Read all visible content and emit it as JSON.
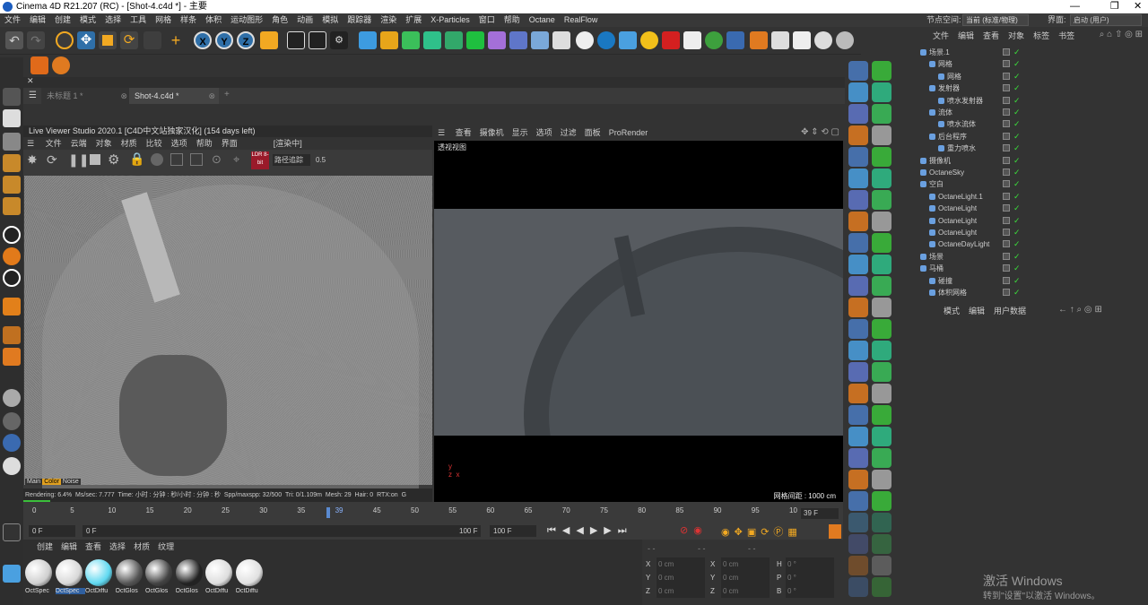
{
  "app": {
    "title": "Cinema 4D R21.207 (RC) - [Shot-4.c4d *] - 主要",
    "node_space_label": "节点空间:",
    "node_space_value": "当前 (标准/物理)",
    "layout_label": "界面:",
    "layout_value": "启动 (用户)"
  },
  "menu": [
    "文件",
    "编辑",
    "创建",
    "模式",
    "选择",
    "工具",
    "网格",
    "样条",
    "体积",
    "运动图形",
    "角色",
    "动画",
    "模拟",
    "跟踪器",
    "渲染",
    "扩展",
    "X-Particles",
    "窗口",
    "帮助",
    "Octane",
    "RealFlow"
  ],
  "tabs": {
    "tab1": "未标题 1 *",
    "tab2": "Shot-4.c4d *",
    "add": "+"
  },
  "live_viewer": {
    "title": "Live Viewer Studio 2020.1 [C4D中文站独家汉化] (154 days left)",
    "menu": [
      "文件",
      "云端",
      "对象",
      "材质",
      "比较",
      "选项",
      "帮助",
      "界面"
    ],
    "status": "[渲染中]",
    "mode_value": "路径追踪",
    "mode_num": "0.5",
    "render_line_1": "Rendering: 6.4%",
    "render_line_2": "Ms/sec: 7.777",
    "render_line_3": "Time: 小时 : 分钟 : 秒/小时 : 分钟 : 秒",
    "render_line_4": "Spp/maxspp: 32/500",
    "render_line_5": "Tri: 0/1.109m",
    "render_line_6": "Mesh: 29",
    "render_line_7": "Hair: 0",
    "render_line_8": "RTX:on",
    "render_line_9": "G",
    "badge": "LDR 8-bit",
    "tabs": [
      "Main",
      "Color",
      "Noise"
    ]
  },
  "viewport": {
    "menu": [
      "查看",
      "摄像机",
      "显示",
      "选项",
      "过滤",
      "面板",
      "ProRender"
    ],
    "label": "透视视图",
    "grid_info": "网格间距 : 1000 cm"
  },
  "timeline": {
    "ticks": [
      "0",
      "5",
      "10",
      "15",
      "20",
      "25",
      "30",
      "35",
      "39",
      "45",
      "50",
      "55",
      "60",
      "65",
      "70",
      "75",
      "80",
      "85",
      "90",
      "95",
      "10"
    ],
    "current_frame": "39 F",
    "start": "0 F",
    "start2": "0 F",
    "end": "100 F",
    "end2": "100 F"
  },
  "material": {
    "menu": [
      "创建",
      "编辑",
      "查看",
      "选择",
      "材质",
      "纹理"
    ],
    "items": [
      "OctSpec",
      "OctSpec",
      "OctDiffu",
      "OctGlos",
      "OctGlos",
      "OctGlos",
      "OctDiffu",
      "OctDiffu"
    ]
  },
  "coords": {
    "rows": [
      {
        "axis": "X",
        "v1": "0 cm",
        "axis2": "X",
        "v2": "0 cm",
        "axis3": "H",
        "v3": "0 °"
      },
      {
        "axis": "Y",
        "v1": "0 cm",
        "axis2": "Y",
        "v2": "0 cm",
        "axis3": "P",
        "v3": "0 °"
      },
      {
        "axis": "Z",
        "v1": "0 cm",
        "axis2": "Z",
        "v2": "0 cm",
        "axis3": "B",
        "v3": "0 °"
      }
    ]
  },
  "objects_panel": {
    "menu": [
      "文件",
      "编辑",
      "查看",
      "对象",
      "标签",
      "书签"
    ],
    "items": [
      {
        "label": "场景.1",
        "indent": 0
      },
      {
        "label": "网格",
        "indent": 1
      },
      {
        "label": "网格",
        "indent": 2
      },
      {
        "label": "发射器",
        "indent": 1
      },
      {
        "label": "喷水发射器",
        "indent": 2
      },
      {
        "label": "流体",
        "indent": 1
      },
      {
        "label": "喷水流体",
        "indent": 2
      },
      {
        "label": "后台程序",
        "indent": 1
      },
      {
        "label": "重力喷水",
        "indent": 2
      },
      {
        "label": "摄像机",
        "indent": 0
      },
      {
        "label": "OctaneSky",
        "indent": 0
      },
      {
        "label": "空白",
        "indent": 0
      },
      {
        "label": "OctaneLight.1",
        "indent": 1
      },
      {
        "label": "OctaneLight",
        "indent": 1
      },
      {
        "label": "OctaneLight",
        "indent": 1
      },
      {
        "label": "OctaneLight",
        "indent": 1
      },
      {
        "label": "OctaneDayLight",
        "indent": 1
      },
      {
        "label": "场景",
        "indent": 0
      },
      {
        "label": "马桶",
        "indent": 0
      },
      {
        "label": "碰撞",
        "indent": 1
      },
      {
        "label": "体积网格",
        "indent": 1
      }
    ]
  },
  "attributes_panel": {
    "menu": [
      "模式",
      "编辑",
      "用户数据"
    ]
  },
  "watermark": {
    "line1": "激活 Windows",
    "line2": "转到\"设置\"以激活 Windows。"
  }
}
